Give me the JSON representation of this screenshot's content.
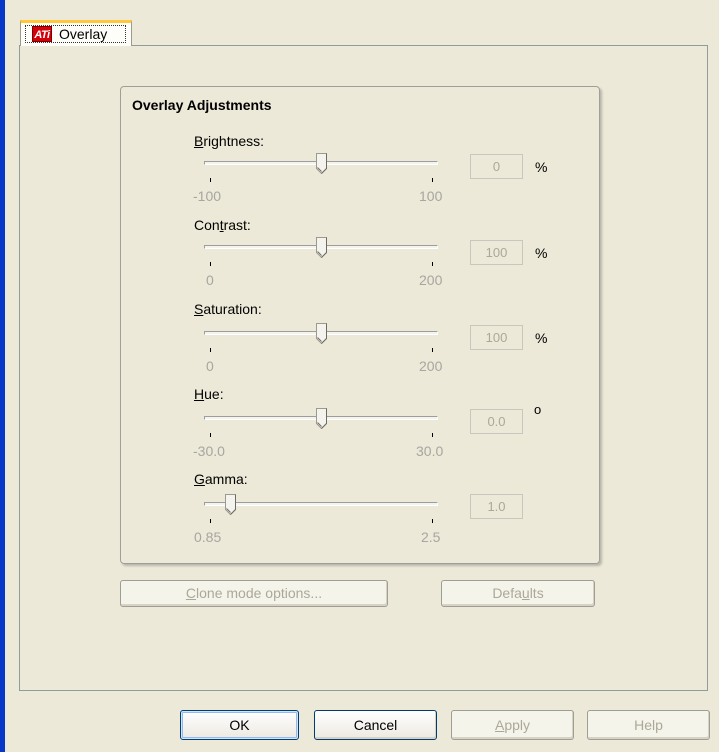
{
  "tab": {
    "label": "Overlay",
    "icon": "ati-logo-icon",
    "icon_text": "ATi"
  },
  "group": {
    "title": "Overlay Adjustments"
  },
  "sliders": [
    {
      "label_pre": "",
      "label_ul": "B",
      "label_post": "rightness:",
      "min": "-100",
      "max": "100",
      "value": "0",
      "unit": "%",
      "level": 0.5
    },
    {
      "label_pre": "Con",
      "label_ul": "t",
      "label_post": "rast:",
      "min": "0",
      "max": "200",
      "value": "100",
      "unit": "%",
      "level": 0.5
    },
    {
      "label_pre": "",
      "label_ul": "S",
      "label_post": "aturation:",
      "min": "0",
      "max": "200",
      "value": "100",
      "unit": "%",
      "level": 0.5
    },
    {
      "label_pre": "",
      "label_ul": "H",
      "label_post": "ue:",
      "min": "-30.0",
      "max": "30.0",
      "value": "0.0",
      "unit": "o",
      "level": 0.5
    },
    {
      "label_pre": "",
      "label_ul": "G",
      "label_post": "amma:",
      "min": "0.85",
      "max": "2.5",
      "value": "1.0",
      "unit": "",
      "level": 0.09
    }
  ],
  "buttons": {
    "clone_ul": "C",
    "clone_rest": "lone mode options...",
    "defaults_pre": "Defa",
    "defaults_ul": "u",
    "defaults_post": "lts",
    "ok": "OK",
    "cancel": "Cancel",
    "apply_ul": "A",
    "apply_rest": "pply",
    "help": "Help"
  },
  "colors": {
    "dialog_bg": "#ece9d8",
    "tab_highlight": "#ffc83c",
    "ati_red": "#d4000a",
    "disabled_text": "#aca899",
    "window_border_blue": "#0a36c8"
  }
}
